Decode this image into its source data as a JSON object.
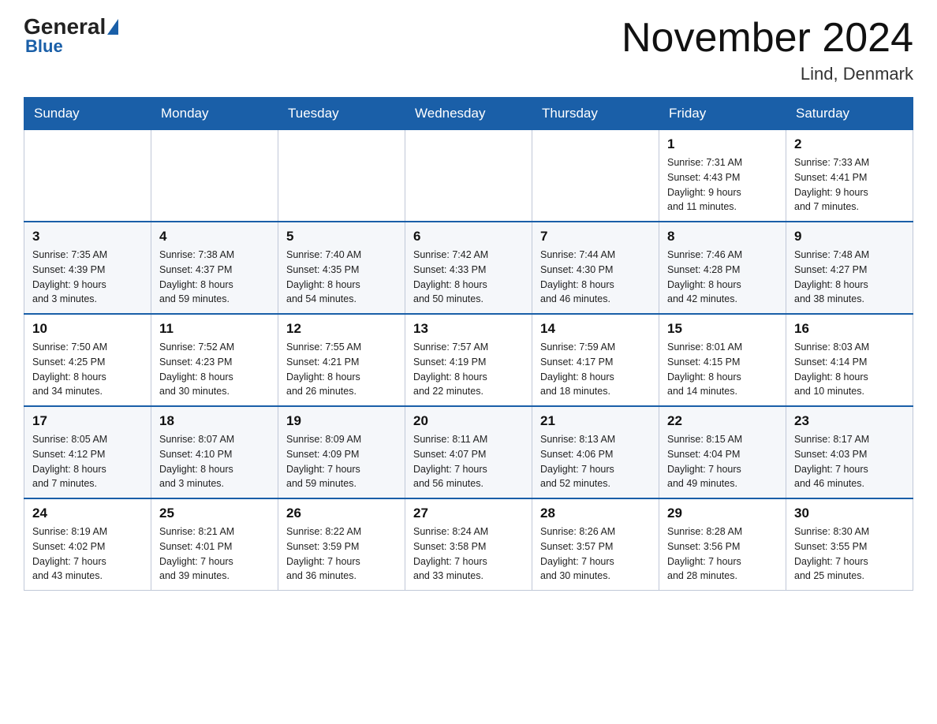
{
  "header": {
    "logo_line1": "General",
    "logo_line2": "Blue",
    "main_title": "November 2024",
    "subtitle": "Lind, Denmark"
  },
  "days_of_week": [
    "Sunday",
    "Monday",
    "Tuesday",
    "Wednesday",
    "Thursday",
    "Friday",
    "Saturday"
  ],
  "weeks": [
    [
      {
        "day": "",
        "info": ""
      },
      {
        "day": "",
        "info": ""
      },
      {
        "day": "",
        "info": ""
      },
      {
        "day": "",
        "info": ""
      },
      {
        "day": "",
        "info": ""
      },
      {
        "day": "1",
        "info": "Sunrise: 7:31 AM\nSunset: 4:43 PM\nDaylight: 9 hours\nand 11 minutes."
      },
      {
        "day": "2",
        "info": "Sunrise: 7:33 AM\nSunset: 4:41 PM\nDaylight: 9 hours\nand 7 minutes."
      }
    ],
    [
      {
        "day": "3",
        "info": "Sunrise: 7:35 AM\nSunset: 4:39 PM\nDaylight: 9 hours\nand 3 minutes."
      },
      {
        "day": "4",
        "info": "Sunrise: 7:38 AM\nSunset: 4:37 PM\nDaylight: 8 hours\nand 59 minutes."
      },
      {
        "day": "5",
        "info": "Sunrise: 7:40 AM\nSunset: 4:35 PM\nDaylight: 8 hours\nand 54 minutes."
      },
      {
        "day": "6",
        "info": "Sunrise: 7:42 AM\nSunset: 4:33 PM\nDaylight: 8 hours\nand 50 minutes."
      },
      {
        "day": "7",
        "info": "Sunrise: 7:44 AM\nSunset: 4:30 PM\nDaylight: 8 hours\nand 46 minutes."
      },
      {
        "day": "8",
        "info": "Sunrise: 7:46 AM\nSunset: 4:28 PM\nDaylight: 8 hours\nand 42 minutes."
      },
      {
        "day": "9",
        "info": "Sunrise: 7:48 AM\nSunset: 4:27 PM\nDaylight: 8 hours\nand 38 minutes."
      }
    ],
    [
      {
        "day": "10",
        "info": "Sunrise: 7:50 AM\nSunset: 4:25 PM\nDaylight: 8 hours\nand 34 minutes."
      },
      {
        "day": "11",
        "info": "Sunrise: 7:52 AM\nSunset: 4:23 PM\nDaylight: 8 hours\nand 30 minutes."
      },
      {
        "day": "12",
        "info": "Sunrise: 7:55 AM\nSunset: 4:21 PM\nDaylight: 8 hours\nand 26 minutes."
      },
      {
        "day": "13",
        "info": "Sunrise: 7:57 AM\nSunset: 4:19 PM\nDaylight: 8 hours\nand 22 minutes."
      },
      {
        "day": "14",
        "info": "Sunrise: 7:59 AM\nSunset: 4:17 PM\nDaylight: 8 hours\nand 18 minutes."
      },
      {
        "day": "15",
        "info": "Sunrise: 8:01 AM\nSunset: 4:15 PM\nDaylight: 8 hours\nand 14 minutes."
      },
      {
        "day": "16",
        "info": "Sunrise: 8:03 AM\nSunset: 4:14 PM\nDaylight: 8 hours\nand 10 minutes."
      }
    ],
    [
      {
        "day": "17",
        "info": "Sunrise: 8:05 AM\nSunset: 4:12 PM\nDaylight: 8 hours\nand 7 minutes."
      },
      {
        "day": "18",
        "info": "Sunrise: 8:07 AM\nSunset: 4:10 PM\nDaylight: 8 hours\nand 3 minutes."
      },
      {
        "day": "19",
        "info": "Sunrise: 8:09 AM\nSunset: 4:09 PM\nDaylight: 7 hours\nand 59 minutes."
      },
      {
        "day": "20",
        "info": "Sunrise: 8:11 AM\nSunset: 4:07 PM\nDaylight: 7 hours\nand 56 minutes."
      },
      {
        "day": "21",
        "info": "Sunrise: 8:13 AM\nSunset: 4:06 PM\nDaylight: 7 hours\nand 52 minutes."
      },
      {
        "day": "22",
        "info": "Sunrise: 8:15 AM\nSunset: 4:04 PM\nDaylight: 7 hours\nand 49 minutes."
      },
      {
        "day": "23",
        "info": "Sunrise: 8:17 AM\nSunset: 4:03 PM\nDaylight: 7 hours\nand 46 minutes."
      }
    ],
    [
      {
        "day": "24",
        "info": "Sunrise: 8:19 AM\nSunset: 4:02 PM\nDaylight: 7 hours\nand 43 minutes."
      },
      {
        "day": "25",
        "info": "Sunrise: 8:21 AM\nSunset: 4:01 PM\nDaylight: 7 hours\nand 39 minutes."
      },
      {
        "day": "26",
        "info": "Sunrise: 8:22 AM\nSunset: 3:59 PM\nDaylight: 7 hours\nand 36 minutes."
      },
      {
        "day": "27",
        "info": "Sunrise: 8:24 AM\nSunset: 3:58 PM\nDaylight: 7 hours\nand 33 minutes."
      },
      {
        "day": "28",
        "info": "Sunrise: 8:26 AM\nSunset: 3:57 PM\nDaylight: 7 hours\nand 30 minutes."
      },
      {
        "day": "29",
        "info": "Sunrise: 8:28 AM\nSunset: 3:56 PM\nDaylight: 7 hours\nand 28 minutes."
      },
      {
        "day": "30",
        "info": "Sunrise: 8:30 AM\nSunset: 3:55 PM\nDaylight: 7 hours\nand 25 minutes."
      }
    ]
  ]
}
